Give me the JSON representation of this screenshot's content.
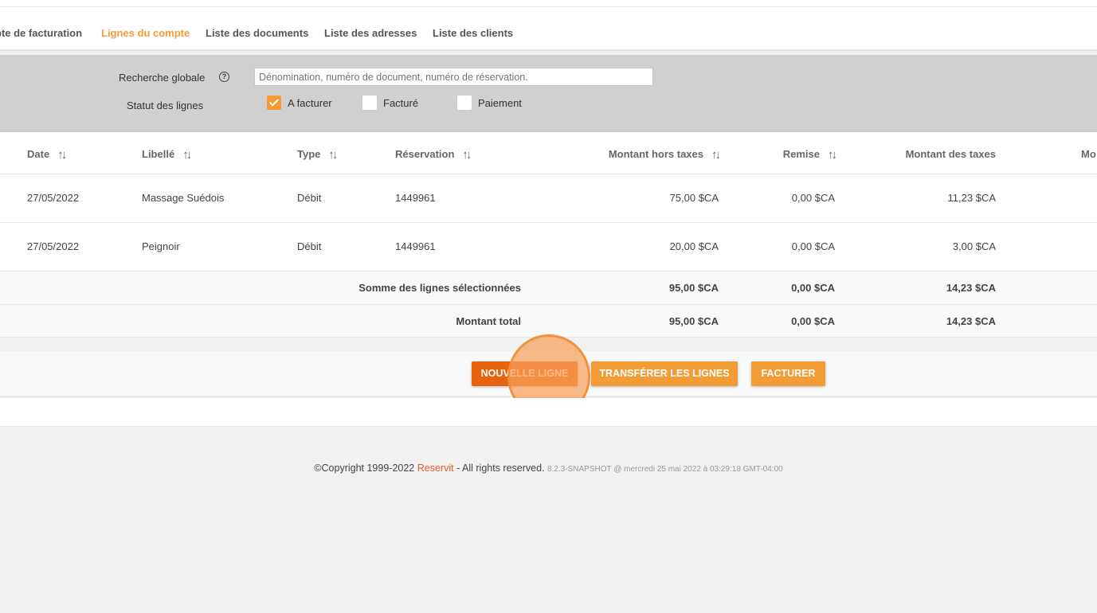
{
  "tabs": [
    {
      "label": "pte de facturation",
      "active": false
    },
    {
      "label": "Lignes du compte",
      "active": true
    },
    {
      "label": "Liste des documents",
      "active": false
    },
    {
      "label": "Liste des adresses",
      "active": false
    },
    {
      "label": "Liste des clients",
      "active": false
    }
  ],
  "filter": {
    "search_label": "Recherche globale",
    "help_icon": "?",
    "search_placeholder": "Dénomination, numéro de document, numéro de réservation.",
    "status_label": "Statut des lignes",
    "statuses": [
      {
        "label": "A facturer",
        "checked": true
      },
      {
        "label": "Facturé",
        "checked": false
      },
      {
        "label": "Paiement",
        "checked": false
      }
    ]
  },
  "table": {
    "sort_icon": "↑↓",
    "headers": {
      "date": "Date",
      "libelle": "Libellé",
      "type": "Type",
      "reservation": "Réservation",
      "montant_ht": "Montant hors taxes",
      "remise": "Remise",
      "montant_taxes": "Montant des taxes",
      "next": "Mo"
    },
    "rows": [
      {
        "date": "27/05/2022",
        "libelle": "Massage Suédois",
        "type": "Débit",
        "reservation": "1449961",
        "montant_ht": "75,00 $CA",
        "remise": "0,00 $CA",
        "montant_taxes": "11,23 $CA"
      },
      {
        "date": "27/05/2022",
        "libelle": "Peignoir",
        "type": "Débit",
        "reservation": "1449961",
        "montant_ht": "20,00 $CA",
        "remise": "0,00 $CA",
        "montant_taxes": "3,00 $CA"
      }
    ],
    "summary": [
      {
        "label": "Somme des lignes sélectionnées",
        "montant_ht": "95,00 $CA",
        "remise": "0,00 $CA",
        "montant_taxes": "14,23 $CA"
      },
      {
        "label": "Montant total",
        "montant_ht": "95,00 $CA",
        "remise": "0,00 $CA",
        "montant_taxes": "14,23 $CA"
      }
    ]
  },
  "actions": {
    "new_line": "NOUVELLE LIGNE",
    "transfer": "TRANSFÉRER LES LIGNES",
    "invoice": "FACTURER"
  },
  "colors": {
    "accent": "#f39c36",
    "new_line_button": "#e8630d",
    "brand": "#e25d22"
  },
  "footer": {
    "copyright": "©Copyright 1999-2022",
    "brand": "Reservit",
    "rights": "- All rights reserved.",
    "version": "8.2.3-SNAPSHOT @ mercredi 25 mai 2022 à 03:29:18 GMT-04:00"
  }
}
